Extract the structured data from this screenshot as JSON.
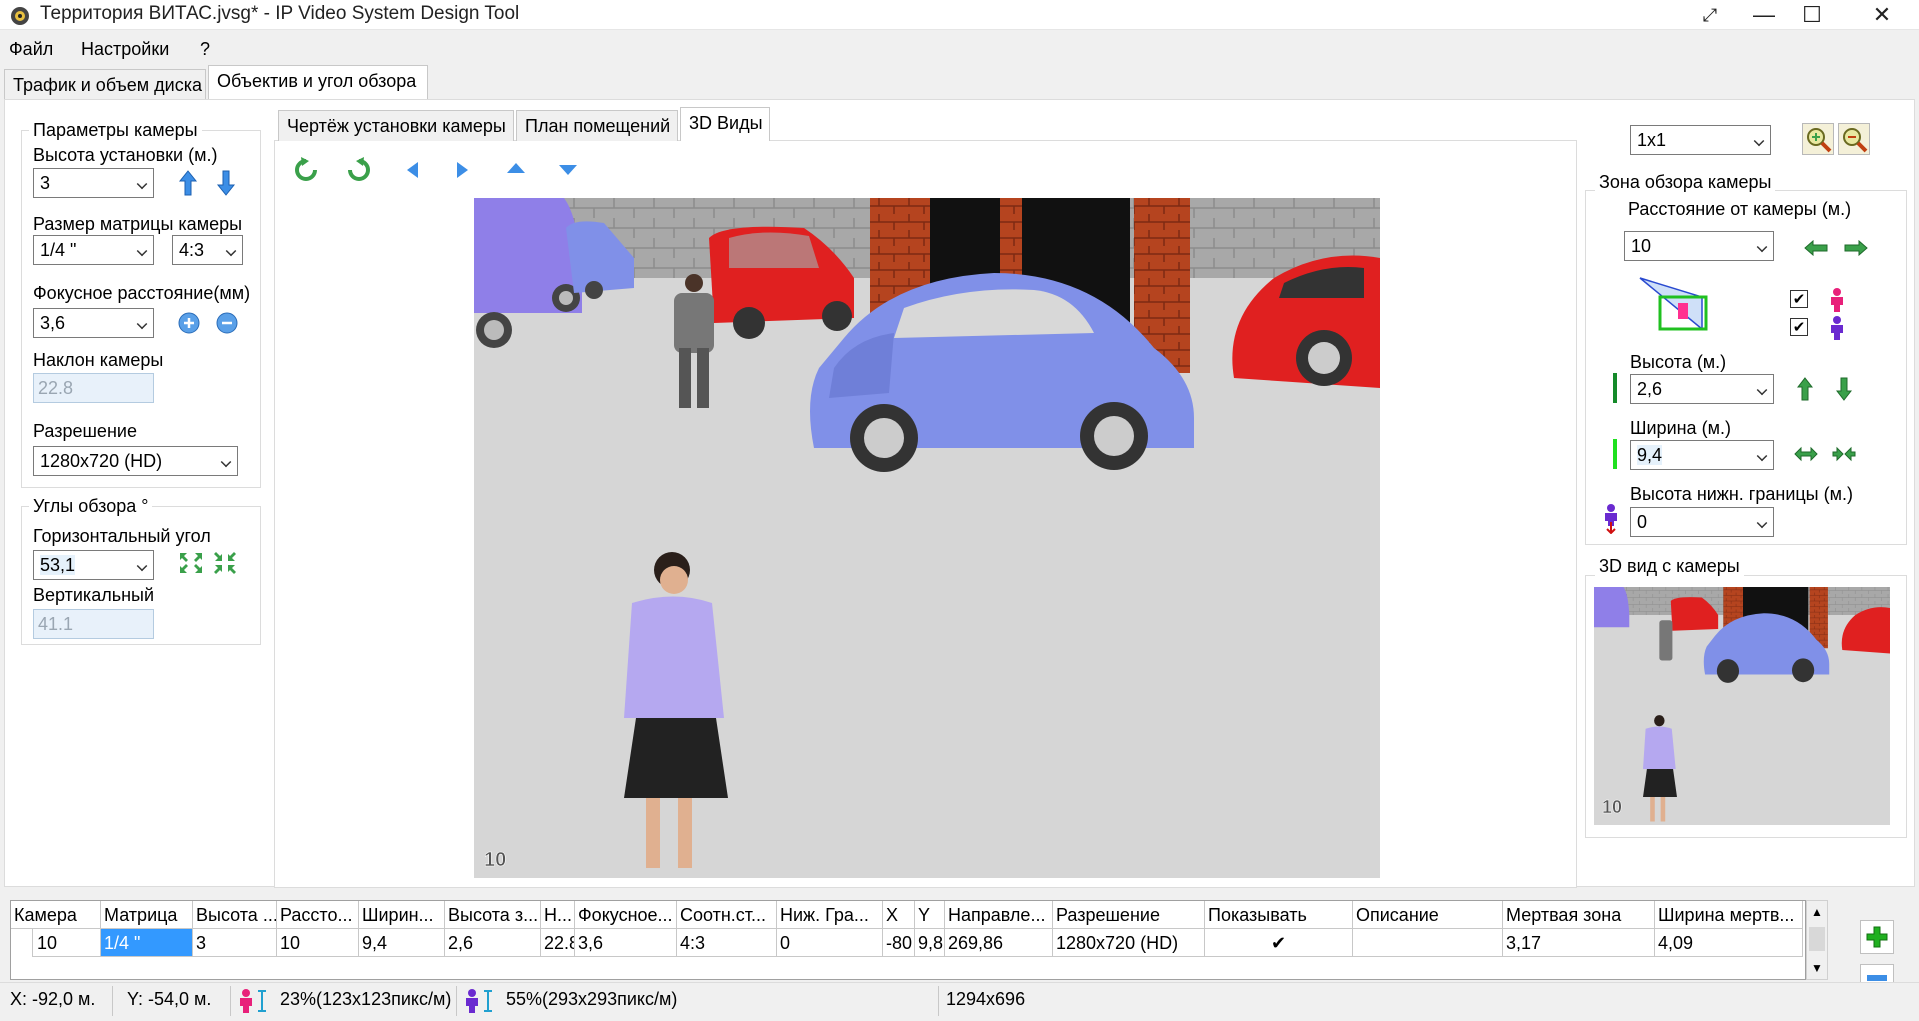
{
  "window": {
    "title": "Территория ВИТАС.jvsg* - IP Video System Design Tool",
    "controls": {
      "restore": "⤢",
      "minimize": "—",
      "maximize": "☐",
      "close": "✕"
    }
  },
  "menu": {
    "file": "Файл",
    "settings": "Настройки",
    "help": "?"
  },
  "main_tabs": {
    "traffic": "Трафик и объем диска",
    "lens": "Объектив и угол обзора"
  },
  "view_tabs": {
    "drawing": "Чертёж установки камеры",
    "plan": "План помещений",
    "views3d": "3D Виды"
  },
  "camera_params": {
    "title": "Параметры камеры",
    "height_label": "Высота установки (м.)",
    "height_value": "3",
    "matrix_label": "Размер матрицы камеры",
    "matrix_value": "1/4 \"",
    "aspect_value": "4:3",
    "focal_label": "Фокусное расстояние(мм)",
    "focal_value": "3,6",
    "tilt_label": "Наклон камеры",
    "tilt_value": "22.8",
    "resolution_label": "Разрешение",
    "resolution_value": "1280x720 (HD)"
  },
  "angles": {
    "title": "Углы обзора °",
    "horizontal_label": "Горизонтальный угол",
    "horizontal_value": "53,1",
    "vertical_label": "Вертикальный",
    "vertical_value": "41.1"
  },
  "viewport": {
    "camera_number": "10"
  },
  "layout_select": {
    "value": "1x1"
  },
  "zone": {
    "title": "Зона обзора камеры",
    "distance_label": "Расстояние от камеры (м.)",
    "distance_value": "10",
    "height_label": "Высота (м.)",
    "height_value": "2,6",
    "width_label": "Ширина (м.)",
    "width_value": "9,4",
    "lower_label": "Высота нижн. границы (м.)",
    "lower_value": "0"
  },
  "preview": {
    "title": "3D вид с камеры",
    "camera_number": "10"
  },
  "table": {
    "headers": [
      "Камера",
      "Матрица",
      "Высота ...",
      "Рассто...",
      "Ширин...",
      "Высота з...",
      "Н...",
      "Фокусное...",
      "Соотн.ст...",
      "Ниж. Гра...",
      "X",
      "Y",
      "Направле...",
      "Разрешение",
      "Показывать",
      "Описание",
      "Мертвая зона",
      "Ширина мертв..."
    ],
    "row": [
      "10",
      "1/4 \"",
      "3",
      "10",
      "9,4",
      "2,6",
      "22.8",
      "3,6",
      "4:3",
      "0",
      "-80",
      "9,8",
      "269,86",
      "1280x720 (HD)",
      "✔",
      "",
      "3,17",
      "4,09"
    ]
  },
  "status": {
    "x": "X: -92,0 м.",
    "y": "Y: -54,0 м.",
    "red_density": "23%(123x123пикс/м)",
    "blue_density": "55%(293x293пикс/м)",
    "size": "1294x696"
  },
  "colors": {
    "accent_blue": "#3c8ee6",
    "green_arrow": "#3aa04a",
    "highlight": "#3399ff"
  }
}
